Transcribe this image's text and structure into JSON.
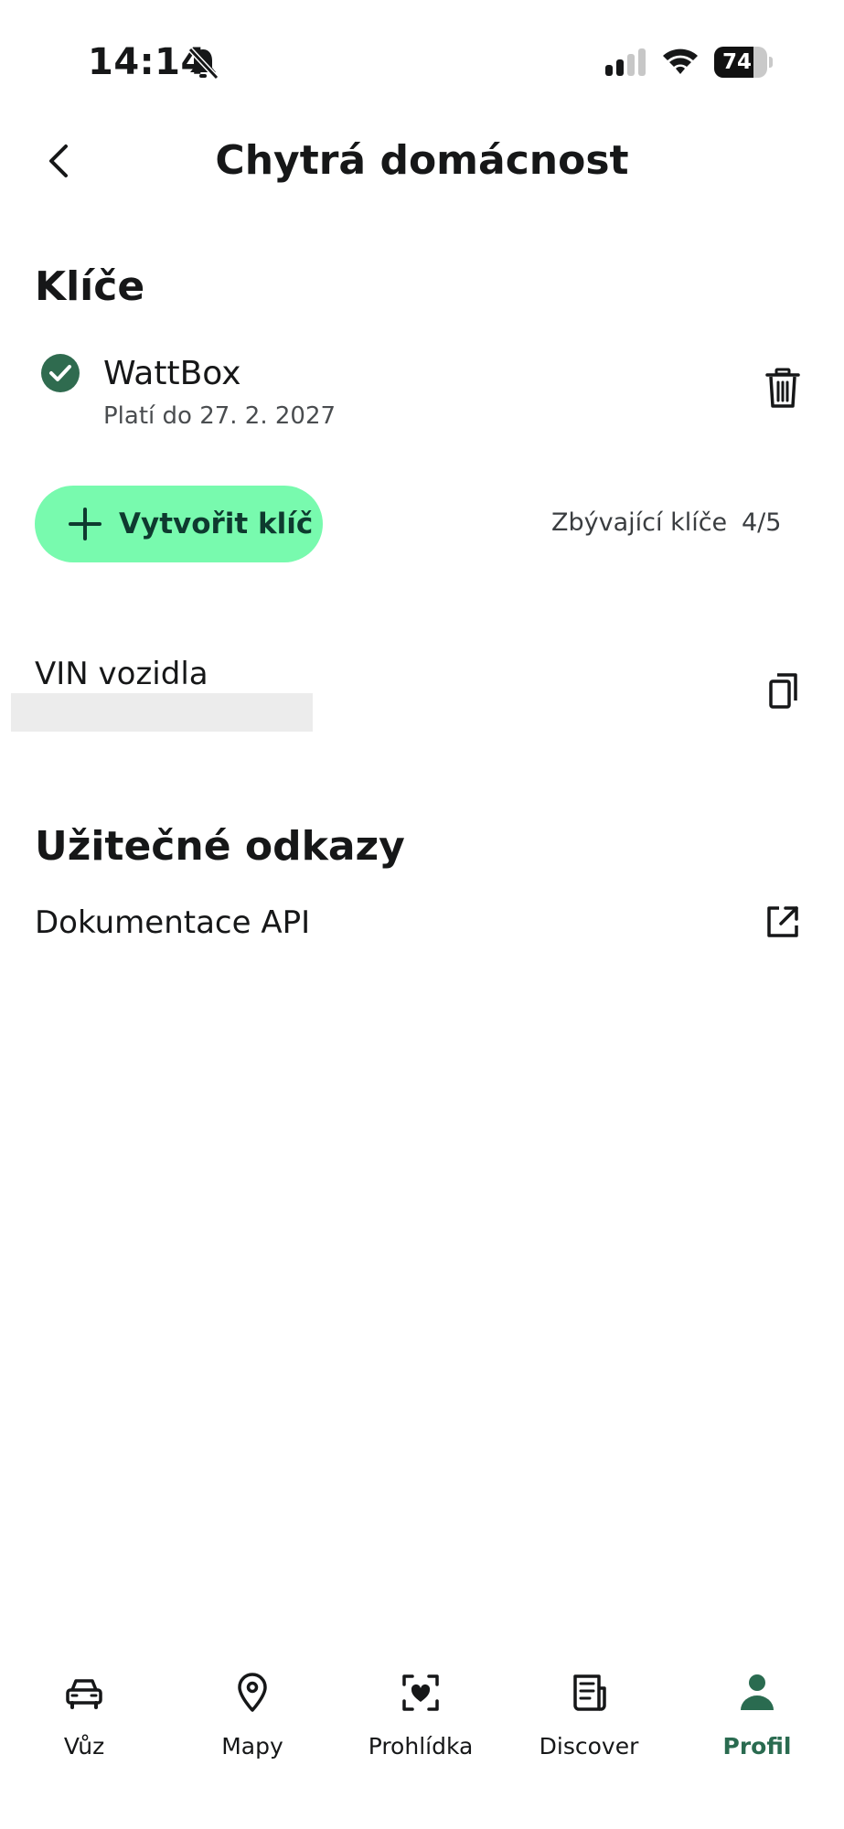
{
  "status_bar": {
    "time": "14:14",
    "battery": "74",
    "battery_level": 0.74
  },
  "header": {
    "title": "Chytrá domácnost"
  },
  "keys": {
    "title": "Klíče",
    "items": [
      {
        "name": "WattBox",
        "validity": "Platí do 27. 2. 2027"
      }
    ],
    "create_label": "Vytvořit klíč",
    "remaining_label": "Zbývající klíče",
    "remaining_value": "4/5"
  },
  "vin": {
    "label": "VIN vozidla"
  },
  "links": {
    "title": "Užitečné odkazy",
    "items": [
      {
        "label": "Dokumentace API"
      }
    ]
  },
  "bottom_nav": {
    "items": [
      {
        "label": "Vůz",
        "icon": "car-icon"
      },
      {
        "label": "Mapy",
        "icon": "map-pin-icon"
      },
      {
        "label": "Prohlídka",
        "icon": "scan-heart-icon"
      },
      {
        "label": "Discover",
        "icon": "news-icon"
      },
      {
        "label": "Profil",
        "icon": "person-icon",
        "active": true
      }
    ]
  },
  "colors": {
    "accent_button": "#78faae",
    "check_green": "#2f6b4f",
    "active_nav": "#2a6b50"
  }
}
